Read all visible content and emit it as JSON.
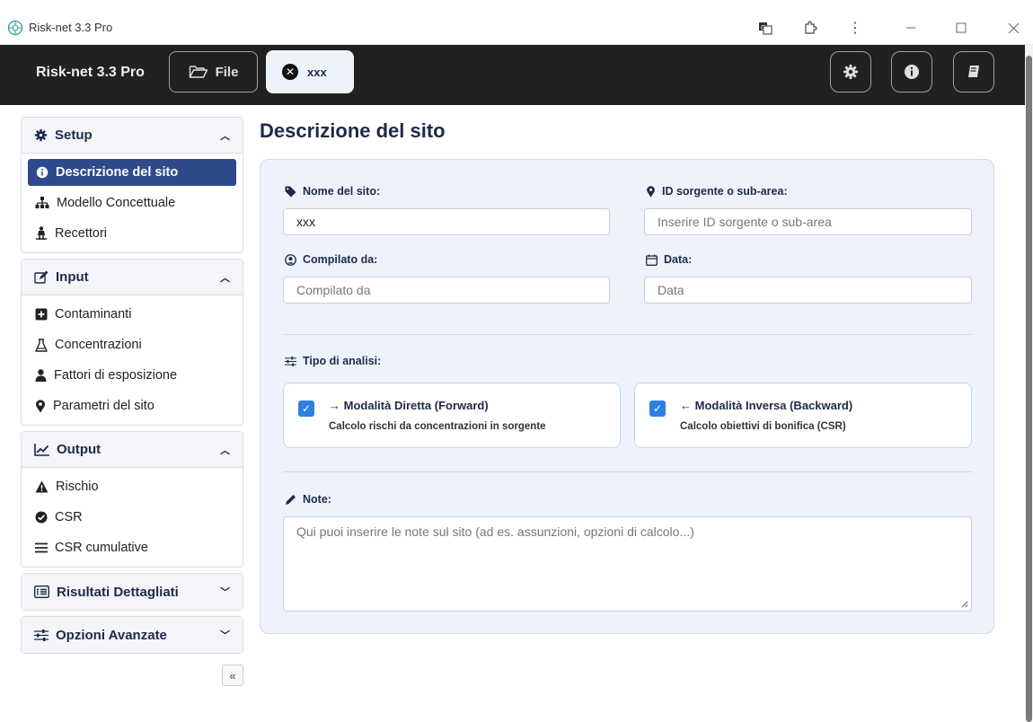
{
  "window": {
    "title": "Risk-net 3.3 Pro"
  },
  "appbar": {
    "brand": "Risk-net 3.3 Pro",
    "file_label": "File",
    "tab_label": "xxx"
  },
  "sidebar": {
    "setup": {
      "label": "Setup",
      "items": [
        {
          "label": "Descrizione del sito"
        },
        {
          "label": "Modello Concettuale"
        },
        {
          "label": "Recettori"
        }
      ]
    },
    "input": {
      "label": "Input",
      "items": [
        {
          "label": "Contaminanti"
        },
        {
          "label": "Concentrazioni"
        },
        {
          "label": "Fattori di esposizione"
        },
        {
          "label": "Parametri del sito"
        }
      ]
    },
    "output": {
      "label": "Output",
      "items": [
        {
          "label": "Rischio"
        },
        {
          "label": "CSR"
        },
        {
          "label": "CSR cumulative"
        }
      ]
    },
    "risultati": {
      "label": "Risultati Dettagliati"
    },
    "opzioni": {
      "label": "Opzioni Avanzate"
    },
    "collapse_label": "«"
  },
  "main": {
    "title": "Descrizione del sito",
    "nome": {
      "label": "Nome del sito:",
      "value": "xxx"
    },
    "id_sorgente": {
      "label": "ID sorgente o sub-area:",
      "placeholder": "Inserire ID sorgente o sub-area"
    },
    "compilato": {
      "label": "Compilato da:",
      "placeholder": "Compilato da"
    },
    "data": {
      "label": "Data:",
      "placeholder": "Data"
    },
    "tipo_label": "Tipo di analisi:",
    "forward": {
      "title": "Modalità Diretta (Forward)",
      "subtitle": "Calcolo rischi da concentrazioni in sorgente",
      "checked": true
    },
    "backward": {
      "title": "Modalità Inversa (Backward)",
      "subtitle": "Calcolo obiettivi di bonifica (CSR)",
      "checked": true
    },
    "note": {
      "label": "Note:",
      "placeholder": "Qui puoi inserire le note sul sito (ad es. assunzioni, opzioni di calcolo...)"
    }
  }
}
